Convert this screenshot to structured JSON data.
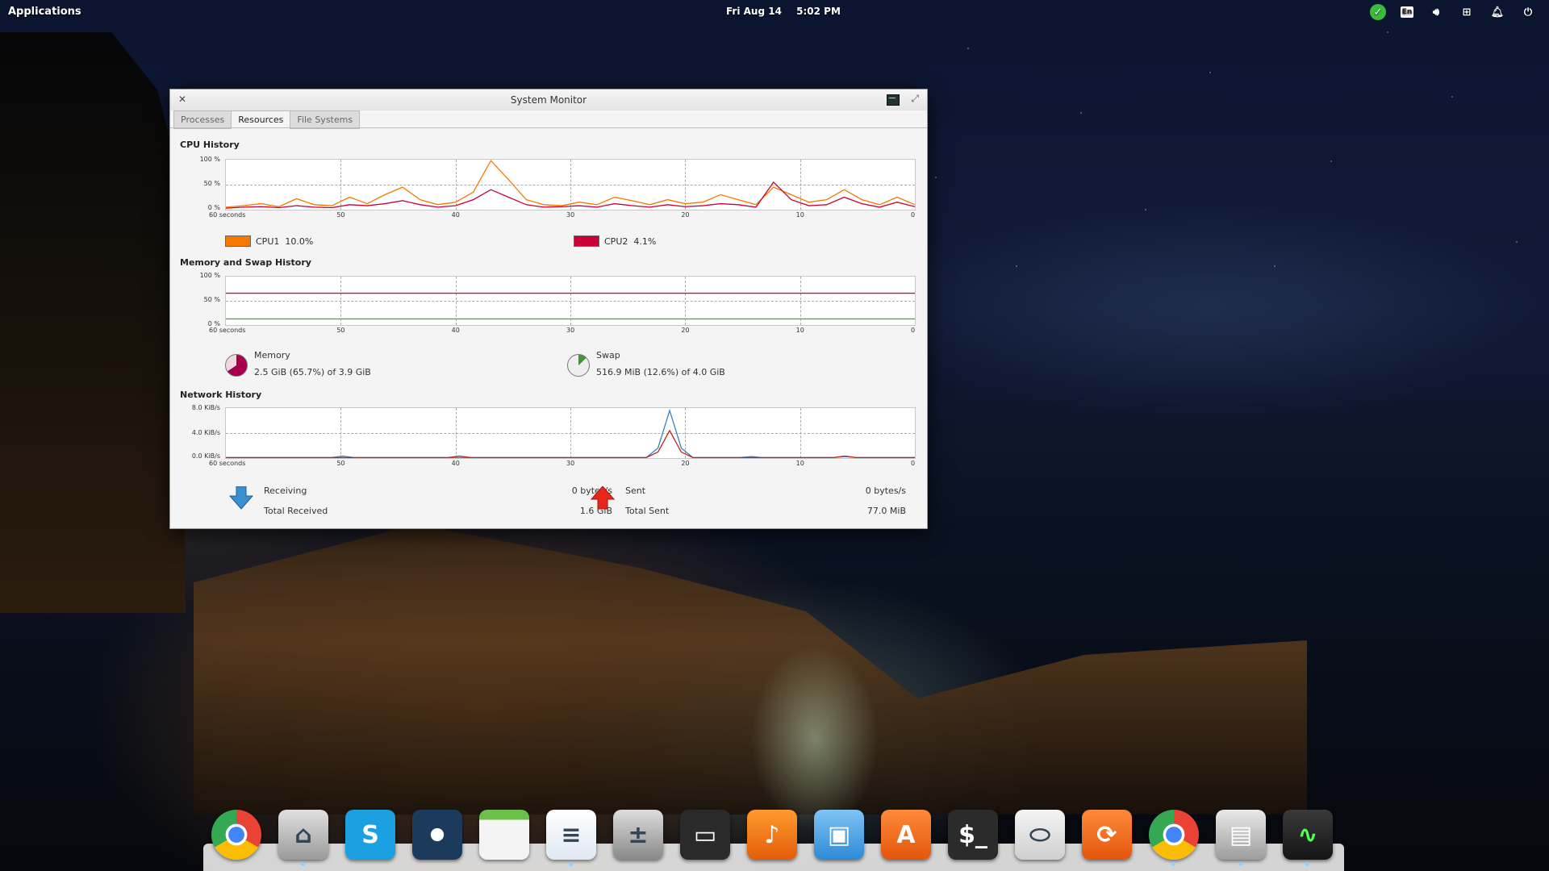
{
  "panel": {
    "applications": "Applications",
    "date": "Fri Aug 14",
    "time": "5:02 PM",
    "keyboard_layout": "En"
  },
  "window": {
    "title": "System Monitor",
    "tabs": [
      {
        "label": "Processes",
        "active": false
      },
      {
        "label": "Resources",
        "active": true
      },
      {
        "label": "File Systems",
        "active": false
      }
    ]
  },
  "cpu": {
    "heading": "CPU History",
    "y_ticks": [
      "100 %",
      "50 %",
      "0 %"
    ],
    "x_ticks": [
      "60 seconds",
      "50",
      "40",
      "30",
      "20",
      "10",
      "0"
    ],
    "cpu1": {
      "name": "CPU1",
      "value": "10.0%",
      "color": "#f57900"
    },
    "cpu2": {
      "name": "CPU2",
      "value": "4.1%",
      "color": "#cc0033"
    }
  },
  "memory": {
    "heading": "Memory and Swap History",
    "y_ticks": [
      "100 %",
      "50 %",
      "0 %"
    ],
    "x_ticks": [
      "60 seconds",
      "50",
      "40",
      "30",
      "20",
      "10",
      "0"
    ],
    "memory_label": "Memory",
    "memory_value": "2.5 GiB (65.7%) of 3.9 GiB",
    "memory_fraction": 0.657,
    "swap_label": "Swap",
    "swap_value": "516.9 MiB (12.6%) of 4.0 GiB",
    "swap_fraction": 0.126
  },
  "network": {
    "heading": "Network History",
    "y_ticks": [
      "8.0 KiB/s",
      "4.0 KiB/s",
      "0.0 KiB/s"
    ],
    "x_ticks": [
      "60 seconds",
      "50",
      "40",
      "30",
      "20",
      "10",
      "0"
    ],
    "receiving_label": "Receiving",
    "receiving_value": "0 bytes/s",
    "total_received_label": "Total Received",
    "total_received_value": "1.6 GiB",
    "sent_label": "Sent",
    "sent_value": "0 bytes/s",
    "total_sent_label": "Total Sent",
    "total_sent_value": "77.0 MiB"
  },
  "dock": [
    {
      "name": "chrome-icon",
      "running": false
    },
    {
      "name": "files-icon",
      "running": true
    },
    {
      "name": "skype-icon",
      "running": false
    },
    {
      "name": "steam-icon",
      "running": false
    },
    {
      "name": "calendar-icon",
      "running": false
    },
    {
      "name": "writer-icon",
      "running": true
    },
    {
      "name": "calculator-icon",
      "running": false
    },
    {
      "name": "screenshot-icon",
      "running": false
    },
    {
      "name": "music-icon",
      "running": false
    },
    {
      "name": "photos-icon",
      "running": false
    },
    {
      "name": "appcenter-icon",
      "running": false
    },
    {
      "name": "terminal-icon",
      "running": false
    },
    {
      "name": "switchboard-icon",
      "running": false
    },
    {
      "name": "update-icon",
      "running": false
    },
    {
      "name": "chrome-icon-2",
      "running": true
    },
    {
      "name": "installer-icon",
      "running": true
    },
    {
      "name": "system-monitor-icon",
      "running": true
    }
  ]
}
